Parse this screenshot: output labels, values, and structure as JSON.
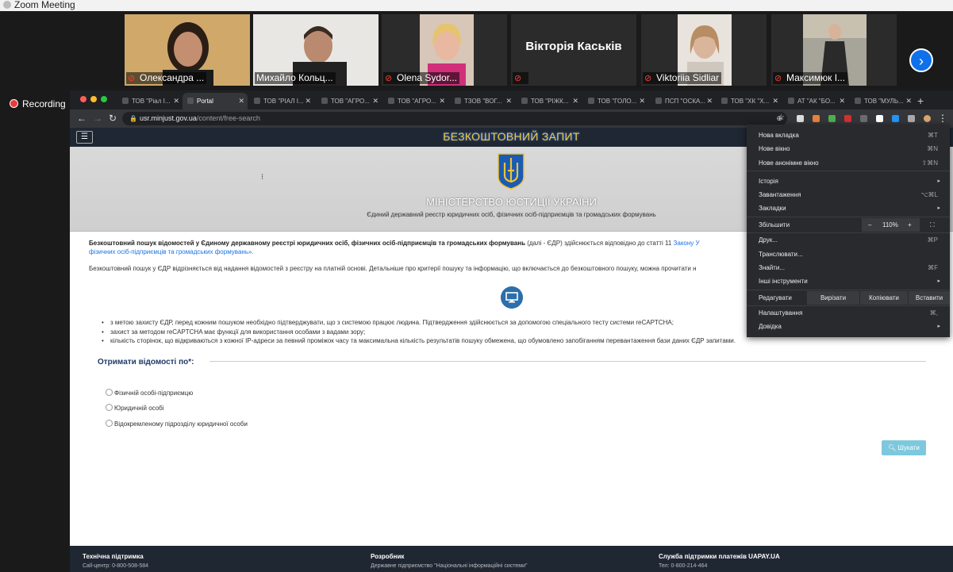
{
  "zoom": {
    "window_title": "Zoom Meeting",
    "participants": [
      {
        "name": "Олександра ...",
        "muted": true
      },
      {
        "name": "Михайло Кольц...",
        "muted": false,
        "active": true
      },
      {
        "name": "Olena Sydor...",
        "muted": true
      },
      {
        "name": "",
        "display_name": "Вікторія Каськів",
        "muted": true
      },
      {
        "name": "Viktoriia Sidliar",
        "muted": true
      },
      {
        "name": "Максимюк І...",
        "muted": true
      }
    ],
    "recording_label": "Recording"
  },
  "browser": {
    "tabs": [
      {
        "label": "ТОВ \"Ріал І...",
        "active": false
      },
      {
        "label": "Portal",
        "active": true
      },
      {
        "label": "ТОВ \"РІАЛ І...",
        "active": false
      },
      {
        "label": "ТОВ \"АГРО...",
        "active": false
      },
      {
        "label": "ТОВ \"АГРО...",
        "active": false
      },
      {
        "label": "ТЗОВ \"ВОГ...",
        "active": false
      },
      {
        "label": "ТОВ \"РІЖК...",
        "active": false
      },
      {
        "label": "ТОВ \"ГОЛО...",
        "active": false
      },
      {
        "label": "ПСП \"ОСКА...",
        "active": false
      },
      {
        "label": "ТОВ \"ХК \"Х...",
        "active": false
      },
      {
        "label": "АТ \"АК \"БО...",
        "active": false
      },
      {
        "label": "ТОВ \"МУЛЬ...",
        "active": false
      }
    ],
    "url_host": "usr.minjust.gov.ua",
    "url_path": "/content/free-search"
  },
  "page": {
    "header_title": "БЕЗКОШТОВНИЙ ЗАПИТ",
    "ministry": "МІНІСТЕРСТВО ЮСТИЦІЇ УКРАЇНИ",
    "registry": "Єдиний державний реєстр юридичних осіб, фізичних осіб-підприємців та громадських формувань",
    "intro_bold": "Безкоштовний пошук відомостей у Єдиному державному реєстрі юридичних осіб, фізичних осіб-підприємців та громадських формувань",
    "intro_rest": " (далі - ЄДР) здійснюється відповідно до статті 11 ",
    "intro_link": "Закону У",
    "intro_link2": "фізичних осіб-підприємців та громадських формувань».",
    "para2": "Безкоштовний пошук у ЄДР відрізняється від надання відомостей з реєстру на платній основі. Детальніше про критерії пошуку та інформацію, що включається до безкоштовного пошуку, можна прочитати н",
    "bullets": [
      "з метою захисту ЄДР, перед кожним пошуком необхідно підтверджувати, що з системою працює людина. Підтвердження здійснюється за допомогою спеціального тесту системи reCAPTCHA;",
      "захист за методом reCAPTCHA має функції для використання особами з вадами зору;",
      "кількість сторінок, що відкриваються з кожної IP-адреси за певний проміжок часу та максимальна кількість результатів пошуку обмежена, що обумовлено запобіганням перевантаження бази даних ЄДР запитами."
    ],
    "get_info_label": "Отримати відомості по*:",
    "options": [
      "Фізичній особі-підприємцю",
      "Юридичній особі",
      "Відокремленому підрозділу юридичної особи"
    ],
    "search_button": "Шукати",
    "footer": [
      {
        "title": "Технічна підтримка",
        "sub": "Call-центр: 0-800-508-584"
      },
      {
        "title": "Розробник",
        "sub": "Державне підприємство \"Національні інформаційні системи\""
      },
      {
        "title": "Служба підтримки платежів UAPAY.UA",
        "sub": "Тел: 0-800-214-464"
      }
    ]
  },
  "menu": {
    "new_tab": "Нова вкладка",
    "new_tab_sc": "⌘T",
    "new_window": "Нове вікно",
    "new_window_sc": "⌘N",
    "incognito": "Нове анонімне вікно",
    "incognito_sc": "⇧⌘N",
    "history": "Історія",
    "downloads": "Завантаження",
    "downloads_sc": "⌥⌘L",
    "bookmarks": "Закладки",
    "zoom": "Збільшити",
    "zoom_minus": "–",
    "zoom_value": "110%",
    "zoom_plus": "+",
    "print": "Друк...",
    "print_sc": "⌘P",
    "cast": "Транслювати...",
    "find": "Знайти...",
    "find_sc": "⌘F",
    "more_tools": "Інші інструменти",
    "edit": "Редагувати",
    "cut": "Вирізати",
    "copy": "Копіювати",
    "paste": "Вставити",
    "settings": "Налаштування",
    "settings_sc": "⌘,",
    "help": "Довідка"
  }
}
